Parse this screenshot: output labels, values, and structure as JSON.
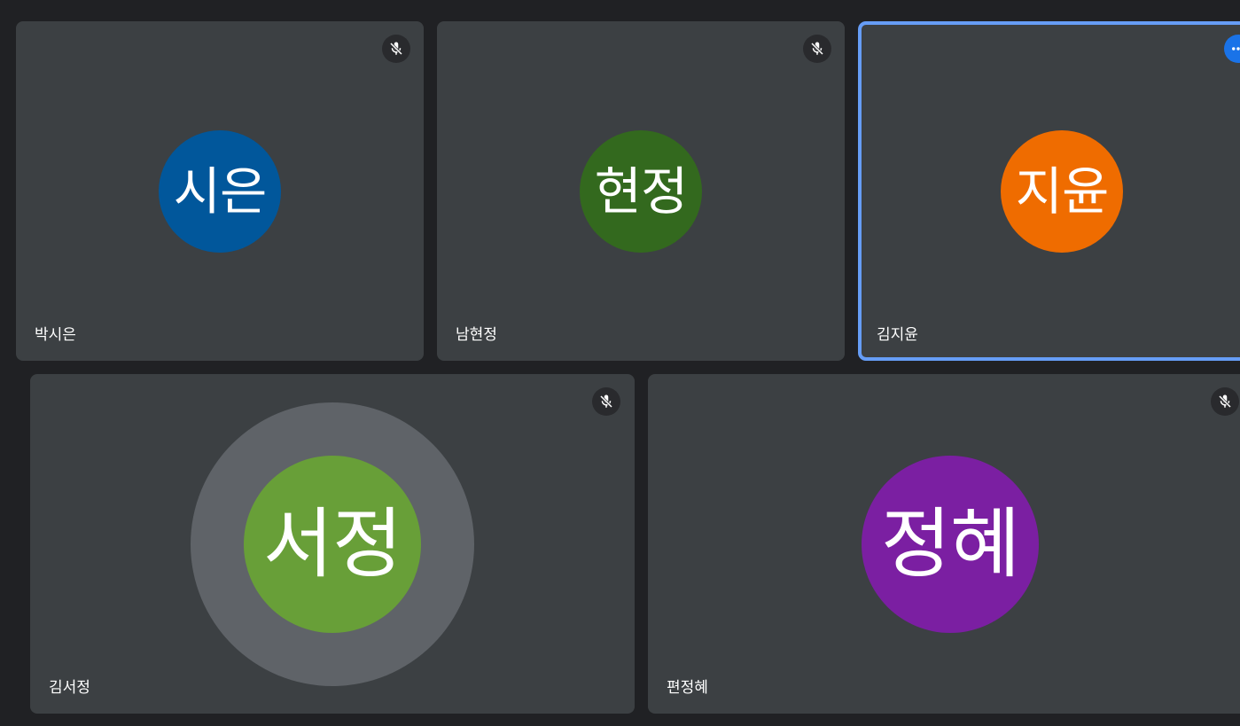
{
  "participants": [
    {
      "name": "박시은",
      "initials": "시은",
      "avatar_color": "#01579b",
      "muted": true,
      "icon": "mic-off-icon"
    },
    {
      "name": "남현정",
      "initials": "현정",
      "avatar_color": "#33691e",
      "muted": true,
      "icon": "mic-off-icon"
    },
    {
      "name": "김지윤",
      "initials": "지윤",
      "avatar_color": "#ef6c00",
      "active": true,
      "icon": "more-options-icon"
    },
    {
      "name": "김서정",
      "initials": "서정",
      "avatar_color": "#689f38",
      "muted": true,
      "speaking": true,
      "icon": "mic-off-icon"
    },
    {
      "name": "편정혜",
      "initials": "정혜",
      "avatar_color": "#7b1fa2",
      "muted": true,
      "icon": "mic-off-icon"
    }
  ],
  "colors": {
    "background": "#202124",
    "tile": "#3c4043",
    "active_border": "#669df6",
    "speaking_ring": "#5f6368",
    "mute_badge": "#292a2d",
    "accent_button": "#1a73e8"
  }
}
